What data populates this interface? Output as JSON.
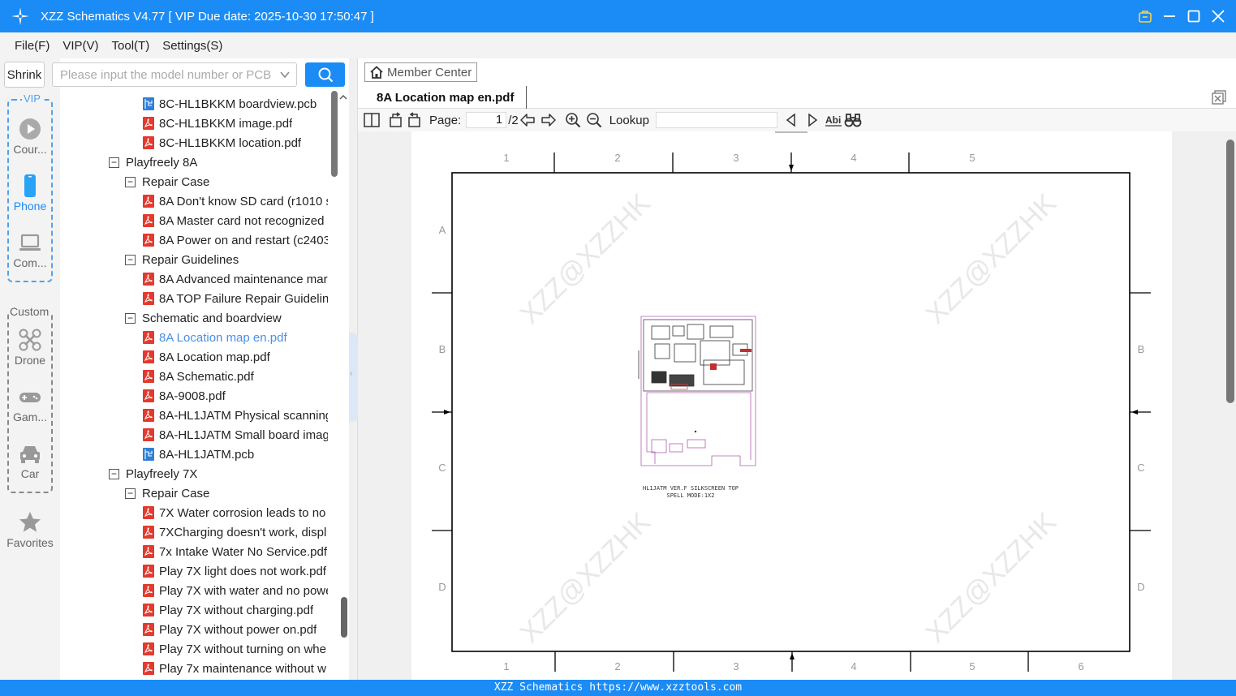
{
  "window": {
    "title": "XZZ Schematics V4.77 [ VIP Due date: 2025-10-30 17:50:47 ]",
    "brand_color": "#1b8bf5"
  },
  "menu": [
    "File(F)",
    "VIP(V)",
    "Tool(T)",
    "Settings(S)"
  ],
  "left_rail": {
    "shrink_label": "Shrink",
    "vip_label": "VIP",
    "vip_items": [
      {
        "label": "Cour...",
        "icon": "play-circle-icon"
      },
      {
        "label": "Phone",
        "icon": "phone-icon"
      },
      {
        "label": "Com...",
        "icon": "laptop-icon"
      }
    ],
    "custom_label": "Custom",
    "custom_items": [
      {
        "label": "Drone",
        "icon": "drone-icon"
      },
      {
        "label": "Gam...",
        "icon": "gamepad-icon"
      },
      {
        "label": "Car",
        "icon": "car-icon"
      }
    ],
    "favorites_label": "Favorites"
  },
  "search": {
    "placeholder": "Please input the model number or PCB"
  },
  "tree": [
    {
      "depth": 2,
      "type": "pcb",
      "label": "8C-HL1BKKM boardview.pcb"
    },
    {
      "depth": 2,
      "type": "pdf",
      "label": "8C-HL1BKKM image.pdf"
    },
    {
      "depth": 2,
      "type": "pdf",
      "label": "8C-HL1BKKM location.pdf"
    },
    {
      "depth": 0,
      "type": "folder",
      "label": "Playfreely 8A"
    },
    {
      "depth": 1,
      "type": "folder",
      "label": "Repair Case"
    },
    {
      "depth": 2,
      "type": "pdf",
      "label": "8A Don't know SD card (r1010 s"
    },
    {
      "depth": 2,
      "type": "pdf",
      "label": "8A Master card not recognized"
    },
    {
      "depth": 2,
      "type": "pdf",
      "label": "8A Power on and restart (c2403"
    },
    {
      "depth": 1,
      "type": "folder",
      "label": "Repair Guidelines"
    },
    {
      "depth": 2,
      "type": "pdf",
      "label": "8A Advanced maintenance mar"
    },
    {
      "depth": 2,
      "type": "pdf",
      "label": "8A TOP Failure Repair Guideline"
    },
    {
      "depth": 1,
      "type": "folder",
      "label": "Schematic and boardview"
    },
    {
      "depth": 2,
      "type": "pdf",
      "label": "8A Location map en.pdf",
      "selected": true
    },
    {
      "depth": 2,
      "type": "pdf",
      "label": "8A Location map.pdf"
    },
    {
      "depth": 2,
      "type": "pdf",
      "label": "8A Schematic.pdf"
    },
    {
      "depth": 2,
      "type": "pdf",
      "label": "8A-9008.pdf"
    },
    {
      "depth": 2,
      "type": "pdf",
      "label": "8A-HL1JATM Physical scanning"
    },
    {
      "depth": 2,
      "type": "pdf",
      "label": "8A-HL1JATM Small board imag"
    },
    {
      "depth": 2,
      "type": "pcb",
      "label": "8A-HL1JATM.pcb"
    },
    {
      "depth": 0,
      "type": "folder",
      "label": "Playfreely 7X"
    },
    {
      "depth": 1,
      "type": "folder",
      "label": "Repair Case"
    },
    {
      "depth": 2,
      "type": "pdf",
      "label": "7X Water corrosion leads to no"
    },
    {
      "depth": 2,
      "type": "pdf",
      "label": "7XCharging doesn't work, displ"
    },
    {
      "depth": 2,
      "type": "pdf",
      "label": "7x Intake Water No Service.pdf"
    },
    {
      "depth": 2,
      "type": "pdf",
      "label": "Play 7X light does not work.pdf"
    },
    {
      "depth": 2,
      "type": "pdf",
      "label": "Play 7X with water and no powe"
    },
    {
      "depth": 2,
      "type": "pdf",
      "label": "Play 7X without charging.pdf"
    },
    {
      "depth": 2,
      "type": "pdf",
      "label": "Play 7X without power on.pdf"
    },
    {
      "depth": 2,
      "type": "pdf",
      "label": "Play 7X without turning on whe"
    },
    {
      "depth": 2,
      "type": "pdf",
      "label": "Play 7x maintenance without w"
    }
  ],
  "viewer": {
    "member_center_label": "Member Center",
    "tab_label": "8A Location map en.pdf",
    "page_label": "Page:",
    "page_current": "1",
    "page_total": "/2",
    "lookup_label": "Lookup"
  },
  "drawing": {
    "top_cols": [
      "1",
      "2",
      "3",
      "4",
      "5"
    ],
    "bottom_cols": [
      "1",
      "2",
      "3",
      "4",
      "5",
      "6"
    ],
    "rows": [
      "A",
      "B",
      "C",
      "D"
    ],
    "watermark": "XZZ@XZZHK",
    "caption_line1": "HL1JATM VER.F SILKSCREEN TOP",
    "caption_line2": "SPELL MODE:1X2"
  },
  "status_text": "XZZ Schematics https://www.xzztools.com"
}
